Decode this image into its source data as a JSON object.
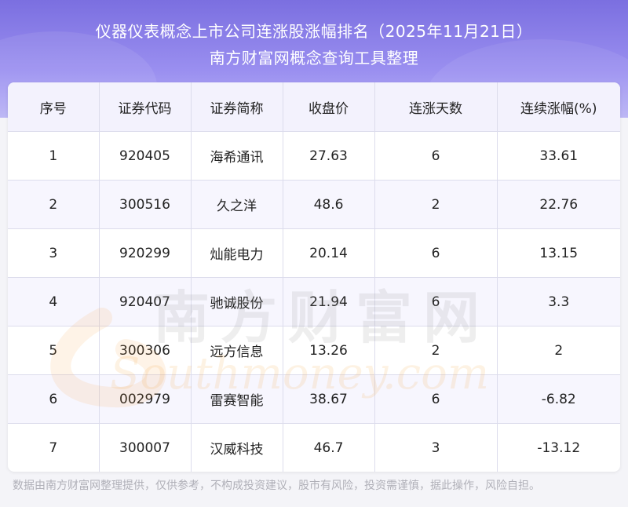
{
  "header": {
    "title_line1": "仪器仪表概念上市公司连涨股涨幅排名（2025年11月21日）",
    "title_line2": "南方财富网概念查询工具整理"
  },
  "table": {
    "columns": [
      "序号",
      "证券代码",
      "证券简称",
      "收盘价",
      "连涨天数",
      "连续涨幅(%)"
    ],
    "rows": [
      [
        "1",
        "920405",
        "海希通讯",
        "27.63",
        "6",
        "33.61"
      ],
      [
        "2",
        "300516",
        "久之洋",
        "48.6",
        "2",
        "22.76"
      ],
      [
        "3",
        "920299",
        "灿能电力",
        "20.14",
        "6",
        "13.15"
      ],
      [
        "4",
        "920407",
        "驰诚股份",
        "21.94",
        "6",
        "3.3"
      ],
      [
        "5",
        "300306",
        "远方信息",
        "13.26",
        "2",
        "2"
      ],
      [
        "6",
        "002979",
        "雷赛智能",
        "38.67",
        "6",
        "-6.82"
      ],
      [
        "7",
        "300007",
        "汉威科技",
        "46.7",
        "3",
        "-13.12"
      ]
    ]
  },
  "watermark": {
    "cn": "南方财富网",
    "en": "Southmoney.com"
  },
  "footer": {
    "disclaimer": "数据由南方财富网整理提供，仅供参考，不构成投资建议，股市有风险，投资需谨慎，据此操作，风险自担。"
  },
  "colors": {
    "header_gradient_top": "#7b6fe0",
    "header_gradient_bottom": "#b8b2f5",
    "table_header_bg": "#f3f2fd",
    "row_alt_bg": "#f7f6fe"
  }
}
